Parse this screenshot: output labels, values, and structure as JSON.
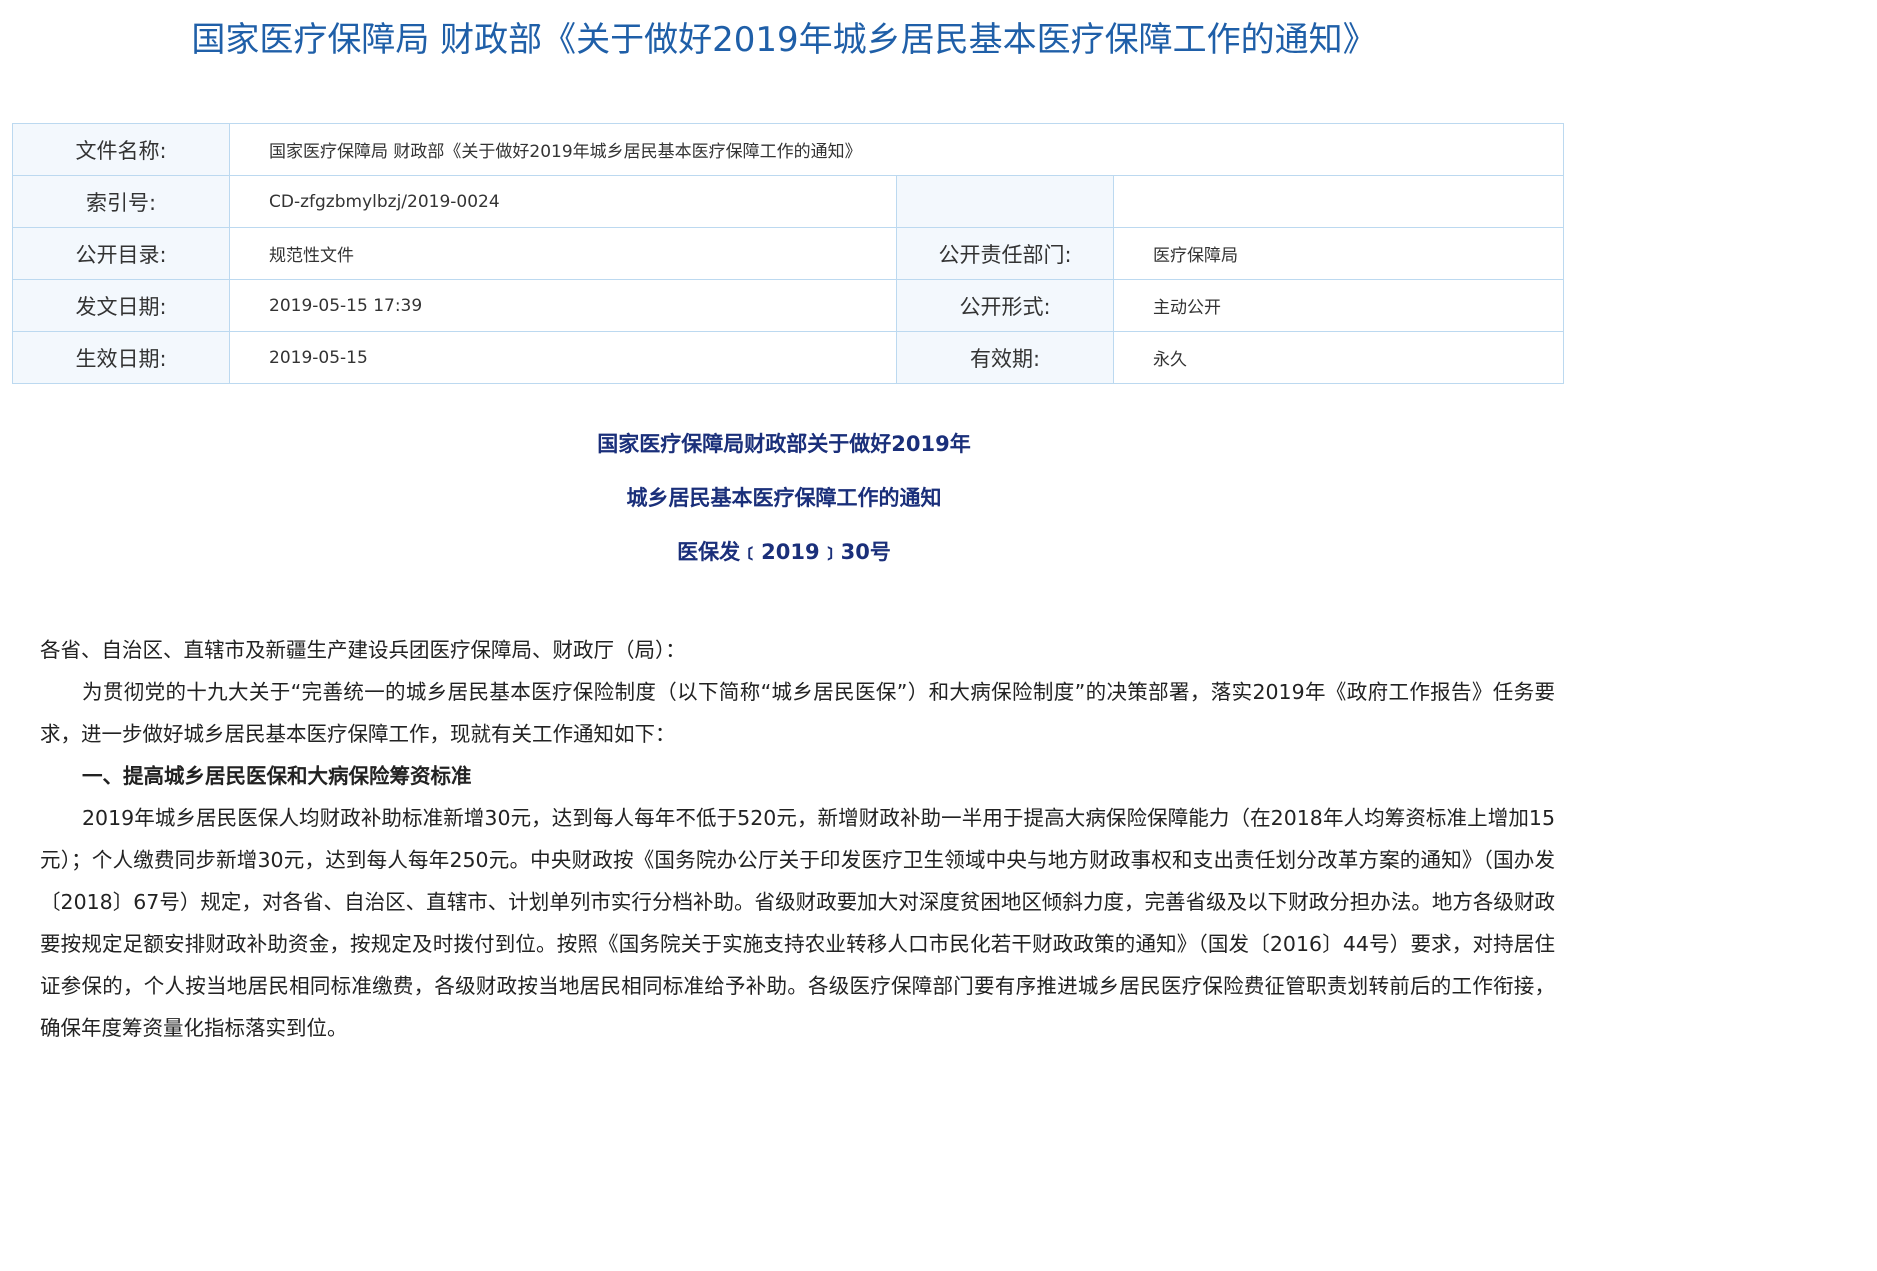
{
  "page": {
    "title": "国家医疗保障局 财政部《关于做好2019年城乡居民基本医疗保障工作的通知》"
  },
  "meta": {
    "file_name_label": "文件名称:",
    "file_name_value": "国家医疗保障局 财政部《关于做好2019年城乡居民基本医疗保障工作的通知》",
    "index_label": "索引号:",
    "index_value": "CD-zfgzbmylbzj/2019-0024",
    "catalog_label": "公开目录:",
    "catalog_value": "规范性文件",
    "dept_label": "公开责任部门:",
    "dept_value": "医疗保障局",
    "date_label": "发文日期:",
    "date_value": "2019-05-15 17:39",
    "form_label": "公开形式:",
    "form_value": "主动公开",
    "effective_label": "生效日期:",
    "effective_value": "2019-05-15",
    "validity_label": "有效期:",
    "validity_value": "永久"
  },
  "doc": {
    "heading_line1": "国家医疗保障局财政部关于做好2019年",
    "heading_line2": "城乡居民基本医疗保障工作的通知",
    "doc_number": "医保发﹝2019﹞30号",
    "salutation": "各省、自治区、直辖市及新疆生产建设兵团医疗保障局、财政厅（局）：",
    "intro": "为贯彻党的十九大关于“完善统一的城乡居民基本医疗保险制度（以下简称“城乡居民医保”）和大病保险制度”的决策部署，落实2019年《政府工作报告》任务要求，进一步做好城乡居民基本医疗保障工作，现就有关工作通知如下：",
    "section1_title": "一、提高城乡居民医保和大病保险筹资标准",
    "section1_para": "2019年城乡居民医保人均财政补助标准新增30元，达到每人每年不低于520元，新增财政补助一半用于提高大病保险保障能力（在2018年人均筹资标准上增加15元）；个人缴费同步新增30元，达到每人每年250元。中央财政按《国务院办公厅关于印发医疗卫生领域中央与地方财政事权和支出责任划分改革方案的通知》（国办发〔2018〕67号）规定，对各省、自治区、直辖市、计划单列市实行分档补助。省级财政要加大对深度贫困地区倾斜力度，完善省级及以下财政分担办法。地方各级财政要按规定足额安排财政补助资金，按规定及时拨付到位。按照《国务院关于实施支持农业转移人口市民化若干财政政策的通知》（国发〔2016〕44号）要求，对持居住证参保的，个人按当地居民相同标准缴费，各级财政按当地居民相同标准给予补助。各级医疗保障部门要有序推进城乡居民医疗保险费征管职责划转前后的工作衔接，确保年度筹资量化指标落实到位。"
  }
}
